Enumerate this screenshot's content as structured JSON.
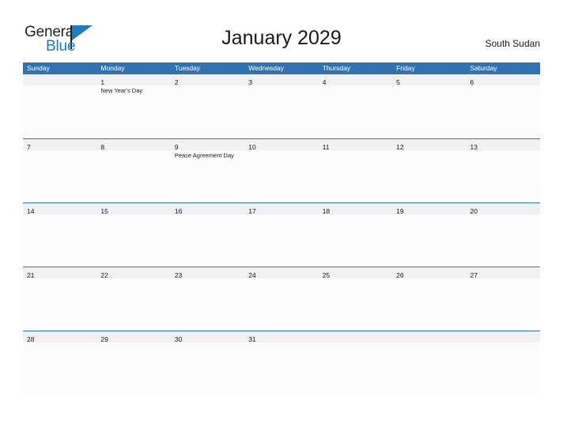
{
  "brand": {
    "name_part1": "General",
    "name_part2": "Blue",
    "flag_icon": "flag-icon",
    "accent_color": "#1E7BC4"
  },
  "header": {
    "title": "January 2029",
    "country": "South Sudan"
  },
  "calendar": {
    "header_bg": "#2E74B5",
    "band_bg": "#F1F1F1",
    "weekday_headers": [
      "Sunday",
      "Monday",
      "Tuesday",
      "Wednesday",
      "Thursday",
      "Friday",
      "Saturday"
    ],
    "weeks": [
      [
        {
          "day": "",
          "events": []
        },
        {
          "day": "1",
          "events": [
            "New Year's Day"
          ]
        },
        {
          "day": "2",
          "events": []
        },
        {
          "day": "3",
          "events": []
        },
        {
          "day": "4",
          "events": []
        },
        {
          "day": "5",
          "events": []
        },
        {
          "day": "6",
          "events": []
        }
      ],
      [
        {
          "day": "7",
          "events": []
        },
        {
          "day": "8",
          "events": []
        },
        {
          "day": "9",
          "events": [
            "Peace Agreement Day"
          ]
        },
        {
          "day": "10",
          "events": []
        },
        {
          "day": "11",
          "events": []
        },
        {
          "day": "12",
          "events": []
        },
        {
          "day": "13",
          "events": []
        }
      ],
      [
        {
          "day": "14",
          "events": []
        },
        {
          "day": "15",
          "events": []
        },
        {
          "day": "16",
          "events": []
        },
        {
          "day": "17",
          "events": []
        },
        {
          "day": "18",
          "events": []
        },
        {
          "day": "19",
          "events": []
        },
        {
          "day": "20",
          "events": []
        }
      ],
      [
        {
          "day": "21",
          "events": []
        },
        {
          "day": "22",
          "events": []
        },
        {
          "day": "23",
          "events": []
        },
        {
          "day": "24",
          "events": []
        },
        {
          "day": "25",
          "events": []
        },
        {
          "day": "26",
          "events": []
        },
        {
          "day": "27",
          "events": []
        }
      ],
      [
        {
          "day": "28",
          "events": []
        },
        {
          "day": "29",
          "events": []
        },
        {
          "day": "30",
          "events": []
        },
        {
          "day": "31",
          "events": []
        },
        {
          "day": "",
          "events": []
        },
        {
          "day": "",
          "events": []
        },
        {
          "day": "",
          "events": []
        }
      ]
    ]
  }
}
